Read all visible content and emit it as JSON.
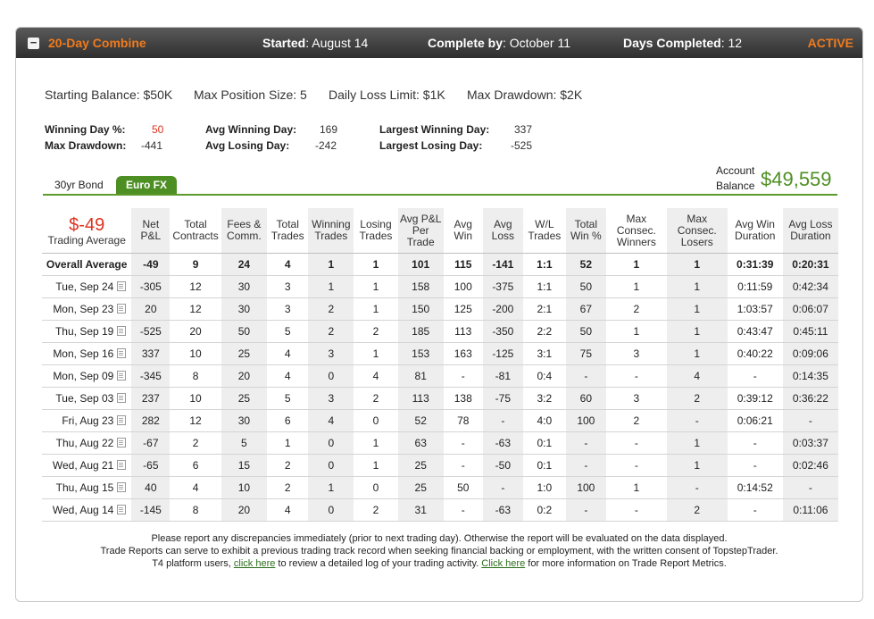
{
  "header": {
    "toggle": "−",
    "title": "20-Day Combine",
    "started_label": "Started",
    "started_value": ": August 14",
    "complete_label": "Complete by",
    "complete_value": ": October 11",
    "days_label": "Days Completed",
    "days_value": ": 12",
    "status": "ACTIVE"
  },
  "summary": {
    "starting_balance": "Starting Balance: $50K",
    "max_position": "Max Position Size: 5",
    "daily_loss": "Daily Loss Limit: $1K",
    "max_drawdown": "Max Drawdown: $2K"
  },
  "stats": {
    "winning_day_pct_label": "Winning Day %:",
    "winning_day_pct": "50",
    "max_drawdown_label": "Max Drawdown:",
    "max_drawdown": "-441",
    "avg_winning_day_label": "Avg Winning Day:",
    "avg_winning_day": "169",
    "avg_losing_day_label": "Avg Losing Day:",
    "avg_losing_day": "-242",
    "largest_winning_day_label": "Largest Winning Day:",
    "largest_winning_day": "337",
    "largest_losing_day_label": "Largest Losing Day:",
    "largest_losing_day": "-525"
  },
  "tabs": [
    {
      "label": "30yr Bond",
      "active": false
    },
    {
      "label": "Euro FX",
      "active": true
    }
  ],
  "account": {
    "label_line1": "Account",
    "label_line2": "Balance",
    "value": "$49,559"
  },
  "table": {
    "trading_average_value": "$-49",
    "trading_average_label": "Trading Average",
    "columns": [
      "Net P&L",
      "Total Contracts",
      "Fees & Comm.",
      "Total Trades",
      "Winning Trades",
      "Losing Trades",
      "Avg P&L Per Trade",
      "Avg Win",
      "Avg Loss",
      "W/L Trades",
      "Total Win %",
      "Max Consec. Winners",
      "Max Consec. Losers",
      "Avg Win Duration",
      "Avg Loss Duration"
    ],
    "overall": {
      "label": "Overall Average",
      "values": [
        "-49",
        "9",
        "24",
        "4",
        "1",
        "1",
        "101",
        "115",
        "-141",
        "1:1",
        "52",
        "1",
        "1",
        "0:31:39",
        "0:20:31"
      ]
    },
    "rows": [
      {
        "date": "Tue, Sep 24",
        "values": [
          "-305",
          "12",
          "30",
          "3",
          "1",
          "1",
          "158",
          "100",
          "-375",
          "1:1",
          "50",
          "1",
          "1",
          "0:11:59",
          "0:42:34"
        ]
      },
      {
        "date": "Mon, Sep 23",
        "values": [
          "20",
          "12",
          "30",
          "3",
          "2",
          "1",
          "150",
          "125",
          "-200",
          "2:1",
          "67",
          "2",
          "1",
          "1:03:57",
          "0:06:07"
        ]
      },
      {
        "date": "Thu, Sep 19",
        "values": [
          "-525",
          "20",
          "50",
          "5",
          "2",
          "2",
          "185",
          "113",
          "-350",
          "2:2",
          "50",
          "1",
          "1",
          "0:43:47",
          "0:45:11"
        ]
      },
      {
        "date": "Mon, Sep 16",
        "values": [
          "337",
          "10",
          "25",
          "4",
          "3",
          "1",
          "153",
          "163",
          "-125",
          "3:1",
          "75",
          "3",
          "1",
          "0:40:22",
          "0:09:06"
        ]
      },
      {
        "date": "Mon, Sep 09",
        "values": [
          "-345",
          "8",
          "20",
          "4",
          "0",
          "4",
          "81",
          "-",
          "-81",
          "0:4",
          "-",
          "-",
          "4",
          "-",
          "0:14:35"
        ]
      },
      {
        "date": "Tue, Sep 03",
        "values": [
          "237",
          "10",
          "25",
          "5",
          "3",
          "2",
          "113",
          "138",
          "-75",
          "3:2",
          "60",
          "3",
          "2",
          "0:39:12",
          "0:36:22"
        ]
      },
      {
        "date": "Fri, Aug 23",
        "values": [
          "282",
          "12",
          "30",
          "6",
          "4",
          "0",
          "52",
          "78",
          "-",
          "4:0",
          "100",
          "2",
          "-",
          "0:06:21",
          "-"
        ]
      },
      {
        "date": "Thu, Aug 22",
        "values": [
          "-67",
          "2",
          "5",
          "1",
          "0",
          "1",
          "63",
          "-",
          "-63",
          "0:1",
          "-",
          "-",
          "1",
          "-",
          "0:03:37"
        ]
      },
      {
        "date": "Wed, Aug 21",
        "values": [
          "-65",
          "6",
          "15",
          "2",
          "0",
          "1",
          "25",
          "-",
          "-50",
          "0:1",
          "-",
          "-",
          "1",
          "-",
          "0:02:46"
        ]
      },
      {
        "date": "Thu, Aug 15",
        "values": [
          "40",
          "4",
          "10",
          "2",
          "1",
          "0",
          "25",
          "50",
          "-",
          "1:0",
          "100",
          "1",
          "-",
          "0:14:52",
          "-"
        ]
      },
      {
        "date": "Wed, Aug 14",
        "values": [
          "-145",
          "8",
          "20",
          "4",
          "0",
          "2",
          "31",
          "-",
          "-63",
          "0:2",
          "-",
          "-",
          "2",
          "-",
          "0:11:06"
        ]
      }
    ]
  },
  "footer": {
    "line1": "Please report any discrepancies immediately (prior to next trading day). Otherwise the report will be evaluated on the data displayed.",
    "line2": "Trade Reports can serve to exhibit a previous trading track record when seeking financial backing or employment, with the written consent of TopstepTrader.",
    "line3_a": "T4 platform users, ",
    "link1": "click here",
    "line3_b": " to review a detailed log of your trading activity. ",
    "link2": "Click here",
    "line3_c": " for more information on Trade Report Metrics."
  },
  "colors": {
    "accent_orange": "#f07a1c",
    "green": "#4e8f24",
    "red": "#e0301e"
  }
}
